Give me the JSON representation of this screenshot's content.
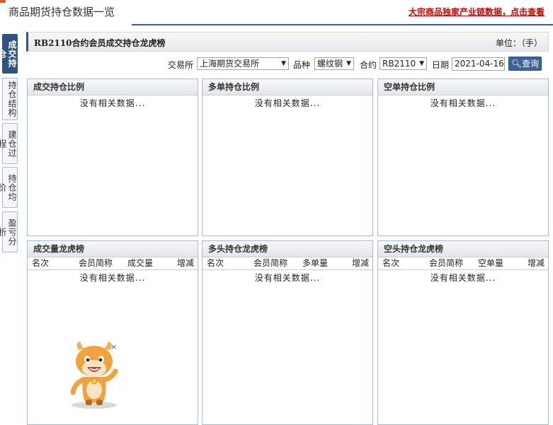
{
  "header": {
    "title": "商品期货持仓数据一览",
    "link": "大宗商品独家产业链数据，点击查看"
  },
  "side_tabs": [
    {
      "label": "成交持仓"
    },
    {
      "label": "持仓结构"
    },
    {
      "label": "建仓过程"
    },
    {
      "label": "持仓均价"
    },
    {
      "label": "盈亏分析"
    }
  ],
  "section": {
    "title": "RB2110合约会员成交持仓龙虎榜",
    "unit": "单位：（手）"
  },
  "filters": {
    "exchange_label": "交易所",
    "exchange_value": "上海期货交易所",
    "variety_label": "品种",
    "variety_value": "螺纹钢",
    "contract_label": "合约",
    "contract_value": "RB2110",
    "date_label": "日期",
    "date_value": "2021-04-16",
    "query_button": "查询"
  },
  "panels_top": [
    {
      "title": "成交持仓比例",
      "empty": "没有相关数据..."
    },
    {
      "title": "多单持仓比例",
      "empty": "没有相关数据..."
    },
    {
      "title": "空单持仓比例",
      "empty": "没有相关数据..."
    }
  ],
  "panels_bottom": [
    {
      "title": "成交量龙虎榜",
      "cols": [
        "名次",
        "会员简称",
        "成交量",
        "增减"
      ],
      "empty": "没有相关数据..."
    },
    {
      "title": "多头持仓龙虎榜",
      "cols": [
        "名次",
        "会员简称",
        "多单量",
        "增减"
      ],
      "empty": "没有相关数据..."
    },
    {
      "title": "空头持仓龙虎榜",
      "cols": [
        "名次",
        "会员简称",
        "空单量",
        "增减"
      ],
      "empty": "没有相关数据..."
    }
  ],
  "mascot": {
    "close": "×"
  },
  "colors": {
    "accent": "#2f5480",
    "link": "#d40000",
    "button": "#3c6397"
  }
}
